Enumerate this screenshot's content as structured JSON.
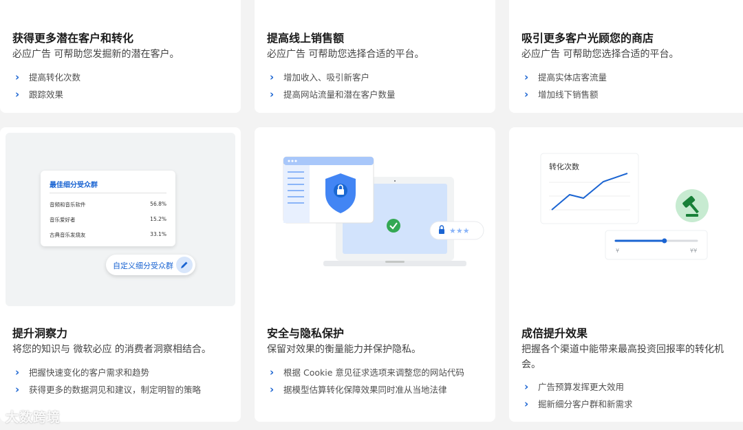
{
  "cards": [
    {
      "title": "获得更多潜在客户和转化",
      "desc": "必应广告 可帮助您发掘新的潜在客户。",
      "bullets": [
        "提高转化次数",
        "跟踪效果"
      ]
    },
    {
      "title": "提高线上销售额",
      "desc": "必应广告 可帮助您选择合适的平台。",
      "bullets": [
        "增加收入、吸引新客户",
        "提高网站流量和潜在客户数量"
      ]
    },
    {
      "title": "吸引更多客户光顾您的商店",
      "desc": "必应广告 可帮助您选择合适的平台。",
      "bullets": [
        "提高实体店客流量",
        "增加线下销售额"
      ]
    },
    {
      "title": "提升洞察力",
      "desc": "将您的知识与 微软必应 的消费者洞察相结合。",
      "bullets": [
        "把握快速变化的客户需求和趋势",
        "获得更多的数据洞见和建议，制定明智的策略"
      ]
    },
    {
      "title": "安全与隐私保护",
      "desc": "保留对效果的衡量能力并保护隐私。",
      "bullets": [
        "根据 Cookie 意见征求选项来调整您的网站代码",
        "据模型估算转化保障效果同时准从当地法律"
      ]
    },
    {
      "title": "成倍提升效果",
      "desc": "把握各个渠道中能带来最高投资回报率的转化机会。",
      "bullets": [
        "广告预算发挥更大效用",
        "掘新细分客户群和新需求"
      ]
    }
  ],
  "segment_card": {
    "title": "最佳细分受众群",
    "rows": [
      {
        "label": "音频和音乐软件",
        "value": "56.8%"
      },
      {
        "label": "音乐爱好者",
        "value": "15.2%"
      },
      {
        "label": "古典音乐发烧友",
        "value": "33.1%"
      }
    ],
    "custom_label": "自定义细分受众群"
  },
  "password_mask": "★★★",
  "conversion_card": {
    "title": "转化次数",
    "slider_min": "¥",
    "slider_max": "¥¥",
    "slider_fraction": 0.6
  },
  "watermark": "大数跨境",
  "colors": {
    "accent": "#1a64d2",
    "shield": "#4285f4",
    "check": "#34a853",
    "gavel_bg": "#c7ebd1",
    "gavel": "#188038"
  }
}
